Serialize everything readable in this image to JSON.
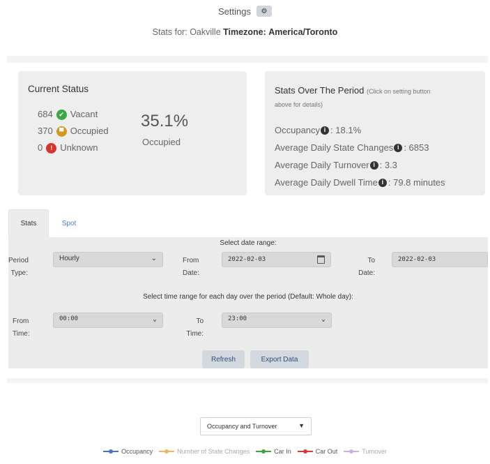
{
  "header": {
    "settings_label": "Settings",
    "stats_prefix": "Stats for:",
    "location": "Oakville",
    "timezone_label": "Timezone:",
    "timezone_value": "America/Toronto"
  },
  "current_status": {
    "title": "Current Status",
    "vacant_count": "684",
    "vacant_label": "Vacant",
    "occupied_count": "370",
    "occupied_label": "Occupied",
    "unknown_count": "0",
    "unknown_label": "Unknown",
    "occupied_pct": "35.1%",
    "occupied_pct_label": "Occupied"
  },
  "period": {
    "title": "Stats Over The Period",
    "hint_a": "(Click on setting button",
    "hint_b": "above for details)",
    "metrics": [
      {
        "label": "Occupancy",
        "value": ": 18.1%"
      },
      {
        "label": "Average Daily State Changes",
        "value": ": 6853"
      },
      {
        "label": "Average Daily Turnover",
        "value": ": 3.3"
      },
      {
        "label": "Average Daily Dwell Time",
        "value": ": 79.8 minutes"
      }
    ]
  },
  "tabs": [
    "Stats",
    "Spot"
  ],
  "form": {
    "date_range_heading": "Select date range:",
    "period_type_label_a": "Period",
    "period_type_label_b": "Type:",
    "period_type_value": "Hourly",
    "from_date_label_a": "From",
    "from_date_label_b": "Date:",
    "from_date_value": "2022-02-03",
    "to_date_label_a": "To",
    "to_date_label_b": "Date:",
    "to_date_value": "2022-02-03",
    "time_range_heading": "Select time range for each day over the period (Default: Whole day):",
    "from_time_label_a": "From",
    "from_time_label_b": "Time:",
    "from_time_value": "00:00",
    "to_time_label_a": "To",
    "to_time_label_b": "Time:",
    "to_time_value": "23:00",
    "refresh_label": "Refresh",
    "export_label": "Export Data"
  },
  "chart_select": {
    "value": "Occupancy and Turnover"
  },
  "legend": [
    {
      "label": "Occupancy",
      "color": "#4a74c9",
      "dimmed": false
    },
    {
      "label": "Number of State Changes",
      "color": "#f2b36b",
      "dimmed": true
    },
    {
      "label": "Car In",
      "color": "#3fa33f",
      "dimmed": false
    },
    {
      "label": "Car Out",
      "color": "#d63a3a",
      "dimmed": false
    },
    {
      "label": "Turnover",
      "color": "#c6b3e0",
      "dimmed": true
    }
  ],
  "icons": {
    "settings": "gear-icon",
    "vacant": "check-circle-icon",
    "occupied": "car-icon",
    "unknown": "exclamation-circle-icon",
    "info": "info-icon",
    "calendar": "calendar-icon"
  }
}
